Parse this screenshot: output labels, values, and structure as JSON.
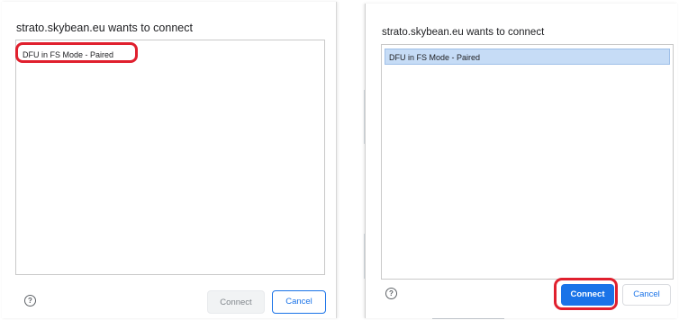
{
  "left_dialog": {
    "title": "strato.skybean.eu wants to connect",
    "devices": [
      {
        "label": "DFU in FS Mode - Paired",
        "selected": false
      }
    ],
    "help_icon": "?",
    "connect_label": "Connect",
    "cancel_label": "Cancel",
    "connect_enabled": false
  },
  "right_dialog": {
    "title": "strato.skybean.eu wants to connect",
    "devices": [
      {
        "label": "DFU in FS Mode - Paired",
        "selected": true
      }
    ],
    "help_icon": "?",
    "connect_label": "Connect",
    "cancel_label": "Cancel",
    "connect_enabled": true
  },
  "colors": {
    "accent_blue": "#1a73e8",
    "selection_fill": "#c6dcf6",
    "annotation_red": "#e0202e"
  }
}
